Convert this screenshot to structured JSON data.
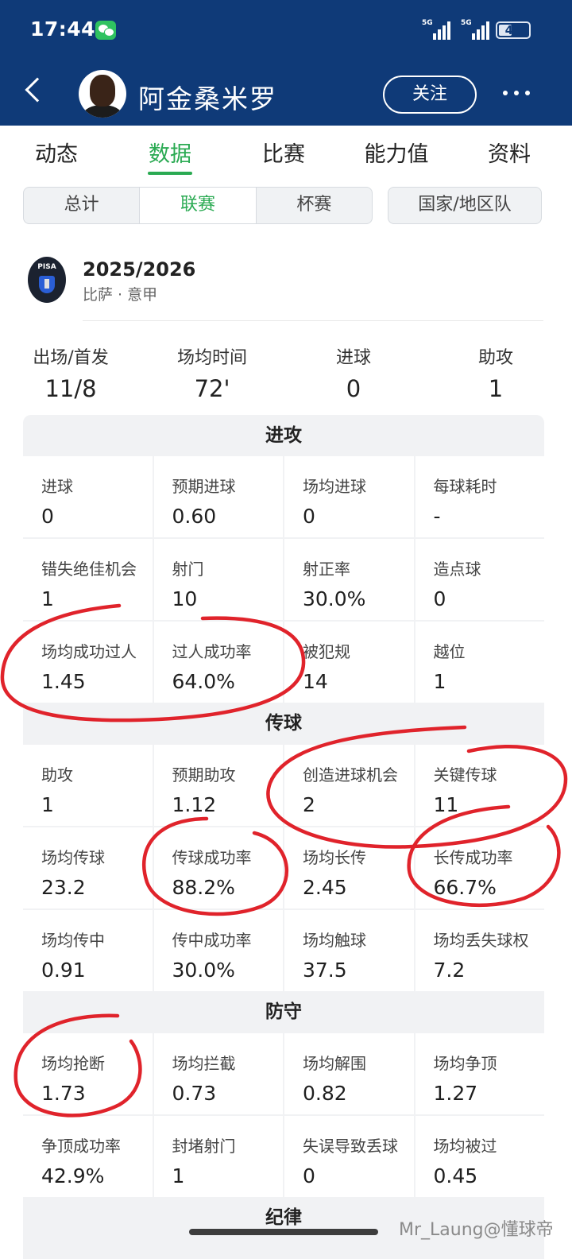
{
  "status_bar": {
    "time": "17:44",
    "network_1": "5G",
    "network_2": "5G",
    "battery": "45",
    "battery_level": 0.45
  },
  "header": {
    "player_name": "阿金桑米罗",
    "follow_label": "关注"
  },
  "tabs": [
    "动态",
    "数据",
    "比赛",
    "能力值",
    "资料"
  ],
  "active_tab": "数据",
  "segments": [
    "总计",
    "联赛",
    "杯赛"
  ],
  "active_segment": "联赛",
  "national_team_label": "国家/地区队",
  "season": {
    "title": "2025/2026",
    "subtitle": "比萨 · 意甲",
    "club_logo_text": "PISA"
  },
  "summary": [
    {
      "label": "出场/首发",
      "value": "11/8"
    },
    {
      "label": "场均时间",
      "value": "72'"
    },
    {
      "label": "进球",
      "value": "0"
    },
    {
      "label": "助攻",
      "value": "1"
    }
  ],
  "sections": [
    {
      "title": "进攻",
      "rows": [
        [
          {
            "label": "进球",
            "value": "0"
          },
          {
            "label": "预期进球",
            "value": "0.60"
          },
          {
            "label": "场均进球",
            "value": "0"
          },
          {
            "label": "每球耗时",
            "value": "-"
          }
        ],
        [
          {
            "label": "错失绝佳机会",
            "value": "1"
          },
          {
            "label": "射门",
            "value": "10"
          },
          {
            "label": "射正率",
            "value": "30.0%"
          },
          {
            "label": "造点球",
            "value": "0"
          }
        ],
        [
          {
            "label": "场均成功过人",
            "value": "1.45"
          },
          {
            "label": "过人成功率",
            "value": "64.0%"
          },
          {
            "label": "被犯规",
            "value": "14"
          },
          {
            "label": "越位",
            "value": "1"
          }
        ]
      ]
    },
    {
      "title": "传球",
      "rows": [
        [
          {
            "label": "助攻",
            "value": "1"
          },
          {
            "label": "预期助攻",
            "value": "1.12"
          },
          {
            "label": "创造进球机会",
            "value": "2"
          },
          {
            "label": "关键传球",
            "value": "11"
          }
        ],
        [
          {
            "label": "场均传球",
            "value": "23.2"
          },
          {
            "label": "传球成功率",
            "value": "88.2%"
          },
          {
            "label": "场均长传",
            "value": "2.45"
          },
          {
            "label": "长传成功率",
            "value": "66.7%"
          }
        ],
        [
          {
            "label": "场均传中",
            "value": "0.91"
          },
          {
            "label": "传中成功率",
            "value": "30.0%"
          },
          {
            "label": "场均触球",
            "value": "37.5"
          },
          {
            "label": "场均丢失球权",
            "value": "7.2"
          }
        ]
      ]
    },
    {
      "title": "防守",
      "rows": [
        [
          {
            "label": "场均抢断",
            "value": "1.73"
          },
          {
            "label": "场均拦截",
            "value": "0.73"
          },
          {
            "label": "场均解围",
            "value": "0.82"
          },
          {
            "label": "场均争顶",
            "value": "1.27"
          }
        ],
        [
          {
            "label": "争顶成功率",
            "value": "42.9%"
          },
          {
            "label": "封堵射门",
            "value": "1"
          },
          {
            "label": "失误导致丢球",
            "value": "0"
          },
          {
            "label": "场均被过",
            "value": "0.45"
          }
        ]
      ]
    },
    {
      "title": "纪律",
      "rows": []
    }
  ],
  "watermark": "Mr_Laung@懂球帝",
  "colors": {
    "header_bg": "#0f3a78",
    "accent_green": "#2aaa52",
    "panel_bg": "#f1f2f4",
    "annotation_red": "#e0232b"
  }
}
